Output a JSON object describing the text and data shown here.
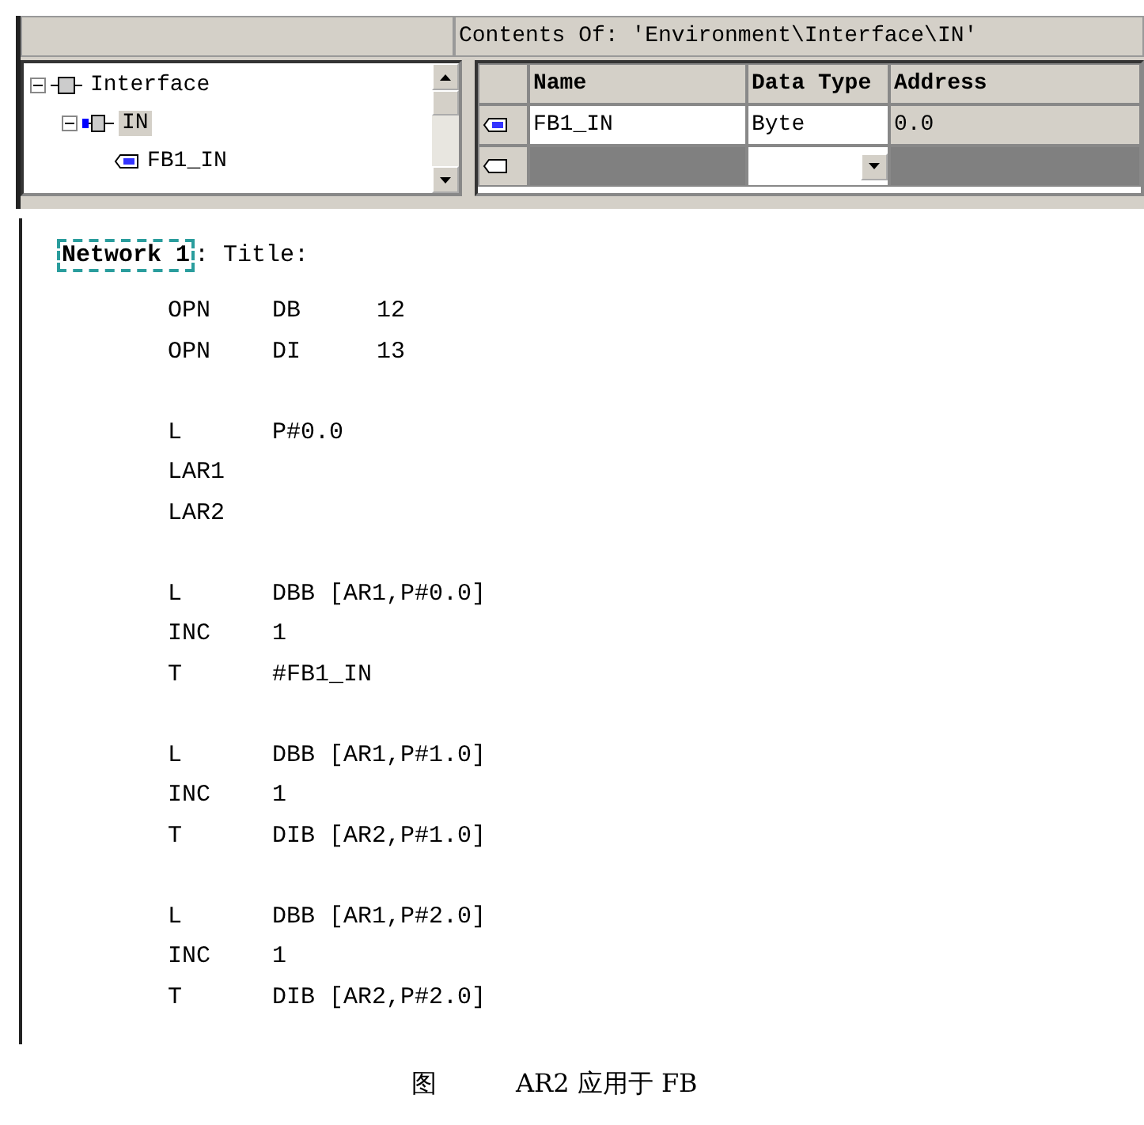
{
  "contents_header": "Contents Of: 'Environment\\Interface\\IN'",
  "tree": [
    {
      "label": "Interface",
      "expanded": true,
      "selected": false,
      "children": [
        {
          "label": "IN",
          "expanded": true,
          "selected": true,
          "children": [
            {
              "label": "FB1_IN",
              "selected": false
            }
          ]
        }
      ]
    }
  ],
  "table": {
    "columns": [
      "Name",
      "Data Type",
      "Address"
    ],
    "rows": [
      {
        "cells": [
          "FB1_IN",
          "Byte",
          "0.0"
        ],
        "kind": "entry"
      },
      {
        "cells": [],
        "kind": "new"
      }
    ]
  },
  "network": {
    "label": "Network 1",
    "title": ": Title:"
  },
  "code_blocks": [
    [
      {
        "op": "OPN",
        "operand": "DB",
        "value": "12"
      },
      {
        "op": "OPN",
        "operand": "DI",
        "value": "13"
      }
    ],
    [
      {
        "op": "L",
        "operand": "P#0.0"
      },
      {
        "op": "LAR1"
      },
      {
        "op": "LAR2"
      }
    ],
    [
      {
        "op": "L",
        "operand": "DBB [AR1,P#0.0]"
      },
      {
        "op": "INC",
        "operand": "1"
      },
      {
        "op": "T",
        "operand": "#FB1_IN"
      }
    ],
    [
      {
        "op": "L",
        "operand": "DBB [AR1,P#1.0]"
      },
      {
        "op": "INC",
        "operand": "1"
      },
      {
        "op": "T",
        "operand": "DIB [AR2,P#1.0]"
      }
    ],
    [
      {
        "op": "L",
        "operand": "DBB [AR1,P#2.0]"
      },
      {
        "op": "INC",
        "operand": "1"
      },
      {
        "op": "T",
        "operand": "DIB [AR2,P#2.0]"
      }
    ]
  ],
  "caption": {
    "label": "图",
    "text": "AR2 应用于 FB"
  }
}
